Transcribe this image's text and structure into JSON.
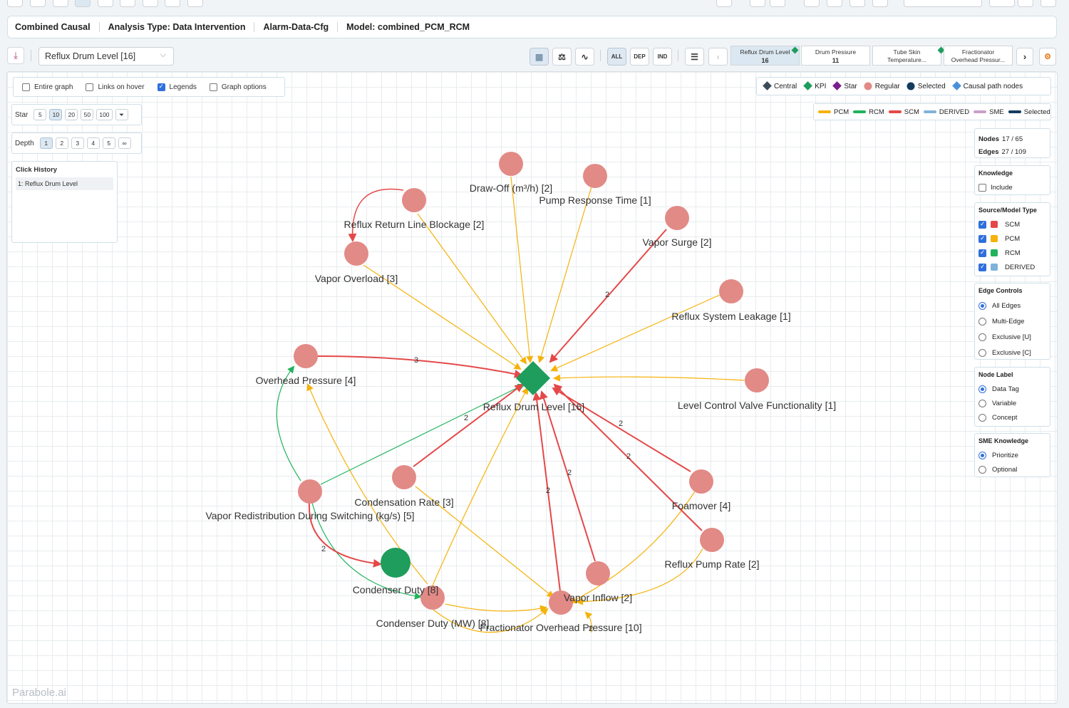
{
  "header": {
    "items": [
      "Combined Causal",
      "Analysis Type: Data Intervention",
      "Alarm-Data-Cfg",
      "Model: combined_PCM_RCM"
    ]
  },
  "toolbar": {
    "node_select_value": "Reflux Drum Level [16]",
    "filter_all": "ALL",
    "filter_dep": "DEP",
    "filter_ind": "IND",
    "kpi_tabs": [
      {
        "label": "Reflux Drum Level",
        "value": "16"
      },
      {
        "label": "Drum Pressure",
        "value": "11"
      },
      {
        "label": "Tube Skin Temperature...",
        "value": ""
      },
      {
        "label": "Fractionator Overhead Pressur...",
        "value": ""
      }
    ]
  },
  "options": {
    "entire_graph": "Entire graph",
    "links_on_hover": "Links on hover",
    "legends": "Legends",
    "graph_options": "Graph options"
  },
  "star": {
    "label": "Star",
    "values": [
      "5",
      "10",
      "20",
      "50",
      "100"
    ],
    "selected": "10"
  },
  "depth": {
    "label": "Depth",
    "values": [
      "1",
      "2",
      "3",
      "4",
      "5",
      "∞"
    ],
    "selected": "1"
  },
  "click_history": {
    "title": "Click History",
    "items": [
      "1: Reflux Drum Level"
    ]
  },
  "legend_nodes": [
    {
      "label": "Central",
      "shape": "diamond",
      "color": "#3b4b5a"
    },
    {
      "label": "KPI",
      "shape": "diamond",
      "color": "#1e9d5c"
    },
    {
      "label": "Star",
      "shape": "diamond",
      "color": "#7b1f8f"
    },
    {
      "label": "Regular",
      "shape": "circle",
      "color": "#e28a86"
    },
    {
      "label": "Selected",
      "shape": "circle",
      "color": "#123b5e"
    },
    {
      "label": "Causal path nodes",
      "shape": "diamond",
      "color": "#4a90d9"
    }
  ],
  "legend_edges": [
    {
      "label": "PCM",
      "color": "#f5b20a"
    },
    {
      "label": "RCM",
      "color": "#21b35c"
    },
    {
      "label": "SCM",
      "color": "#e54848"
    },
    {
      "label": "DERIVED",
      "color": "#7fb2d9"
    },
    {
      "label": "SME",
      "color": "#c9a0c9"
    },
    {
      "label": "Selected",
      "color": "#123b5e"
    }
  ],
  "stats": {
    "nodes_label": "Nodes",
    "nodes_value": "17 / 65",
    "edges_label": "Edges",
    "edges_value": "27 / 109"
  },
  "knowledge": {
    "title": "Knowledge",
    "include": "Include"
  },
  "source_model": {
    "title": "Source/Model Type",
    "items": [
      {
        "label": "SCM",
        "color": "#e54848"
      },
      {
        "label": "PCM",
        "color": "#f5b20a"
      },
      {
        "label": "RCM",
        "color": "#21b35c"
      },
      {
        "label": "DERIVED",
        "color": "#7fb2d9"
      }
    ]
  },
  "edge_controls": {
    "title": "Edge Controls",
    "items": [
      "All Edges",
      "Multi-Edge",
      "Exclusive [U]",
      "Exclusive [C]"
    ],
    "selected": 0
  },
  "node_label": {
    "title": "Node Label",
    "items": [
      "Data Tag",
      "Variable",
      "Concept"
    ],
    "selected": 0
  },
  "sme_knowledge": {
    "title": "SME Knowledge",
    "items": [
      "Prioritize",
      "Optional"
    ],
    "selected": 0
  },
  "graph": {
    "central": {
      "label": "Reflux Drum Level [16]"
    },
    "nodes": [
      {
        "id": "drawoff",
        "label": "Draw-Off (m³/h) [2]"
      },
      {
        "id": "pump",
        "label": "Pump Response Time [1]"
      },
      {
        "id": "rrlb",
        "label": "Reflux Return Line Blockage [2]"
      },
      {
        "id": "vsurge",
        "label": "Vapor Surge [2]"
      },
      {
        "id": "voverload",
        "label": "Vapor Overload [3]"
      },
      {
        "id": "rsl",
        "label": "Reflux System Leakage [1]"
      },
      {
        "id": "ovp",
        "label": "Overhead Pressure [4]"
      },
      {
        "id": "lcv",
        "label": "Level Control Valve Functionality [1]"
      },
      {
        "id": "cond_rate",
        "label": "Condensation Rate [3]"
      },
      {
        "id": "vrds",
        "label": "Vapor Redistribution During Switching (kg/s) [5]"
      },
      {
        "id": "foam",
        "label": "Foamover [4]"
      },
      {
        "id": "cduty_kpi",
        "label": "Condenser Duty [8]"
      },
      {
        "id": "rpr",
        "label": "Reflux Pump Rate [2]"
      },
      {
        "id": "vinflow",
        "label": "Vapor Inflow [2]"
      },
      {
        "id": "cduty_mw",
        "label": "Condenser Duty (MW) [8]"
      },
      {
        "id": "fop",
        "label": "Fractionator Overhead Pressure [10]"
      }
    ],
    "edge_labels": [
      "3",
      "2",
      "2",
      "2",
      "2",
      "2",
      "2",
      "2",
      "2"
    ]
  },
  "brand": "Parabole.ai"
}
